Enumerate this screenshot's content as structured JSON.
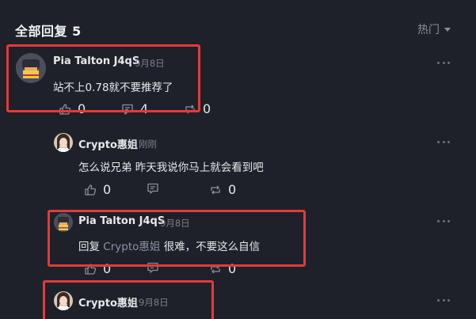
{
  "header": {
    "title": "全部回复 5",
    "sort_label": "热门"
  },
  "comments": [
    {
      "name": "Pia Talton J4qS",
      "time": "9月8日",
      "text": "站不上0.78就不要推荐了",
      "likes": "0",
      "comments": "4",
      "reposts": "0"
    },
    {
      "name": "Crypto惠姐",
      "time": "刚刚",
      "text": "怎么说兄弟 昨天我说你马上就会看到吧",
      "likes": "0",
      "reposts": "0"
    },
    {
      "name": "Pia Talton J4qS",
      "time": "9月8日",
      "reply_prefix": "回复",
      "reply_to": "Crypto惠姐",
      "text": "很难，不要这么自信",
      "likes": "0",
      "reposts": "0"
    },
    {
      "name": "Crypto惠姐",
      "time": "9月8日"
    }
  ],
  "colors": {
    "background": "#1e2129",
    "highlight_border": "#e5393a",
    "text_muted": "#7b808a"
  }
}
